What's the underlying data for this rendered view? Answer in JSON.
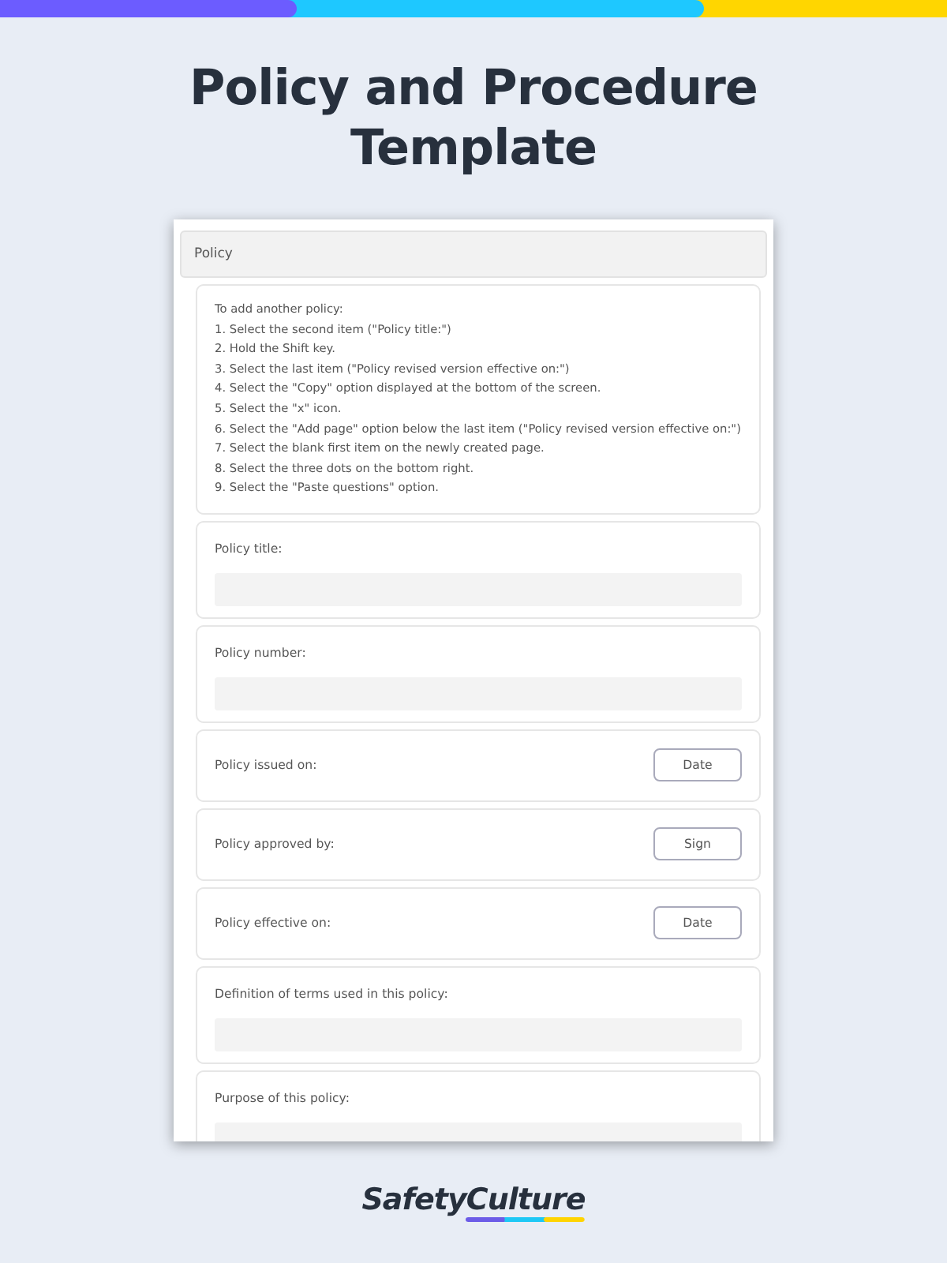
{
  "title": "Policy and Procedure Template",
  "form": {
    "section": "Policy",
    "instructions": [
      "To add another policy:",
      "1. Select the second item (\"Policy title:\")",
      "2. Hold the Shift key.",
      "3. Select the last item (\"Policy revised version effective on:\")",
      "4. Select the \"Copy\" option displayed at the bottom of the screen.",
      "5. Select the \"x\" icon.",
      "6. Select the \"Add page\" option below the last item (\"Policy revised version effective on:\")",
      "7. Select the blank first item on the newly created page.",
      "8. Select the three dots on the bottom right.",
      "9. Select the \"Paste questions\" option."
    ],
    "items": [
      {
        "kind": "text",
        "label": "Policy title:"
      },
      {
        "kind": "text",
        "label": "Policy number:"
      },
      {
        "kind": "button",
        "label": "Policy issued on:",
        "button": "Date"
      },
      {
        "kind": "button",
        "label": "Policy approved by:",
        "button": "Sign"
      },
      {
        "kind": "button",
        "label": "Policy effective on:",
        "button": "Date"
      },
      {
        "kind": "text",
        "label": "Definition of terms used in this policy:"
      },
      {
        "kind": "text",
        "label": "Purpose of this policy:"
      }
    ]
  },
  "brand": {
    "first": "Safety",
    "second": "Culture"
  }
}
